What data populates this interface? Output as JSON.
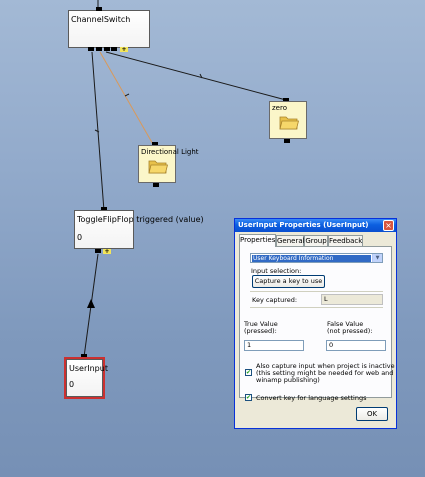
{
  "canvas": {
    "background_color": "#8fa8cb",
    "wire_color": "#1a1a1a",
    "highlight_wire_color": "#d9995a"
  },
  "nodes": {
    "channel_switch": {
      "title": "ChannelSwitch"
    },
    "zero": {
      "title": "zero"
    },
    "directional_light": {
      "title": "Directional Light"
    },
    "toggle_flipflop": {
      "title": "ToggleFlipFlop triggered (value)",
      "value": "0"
    },
    "user_input": {
      "title": "UserInput",
      "value": "0"
    },
    "plus_glyph": "+"
  },
  "dialog": {
    "title": "UserInput Properties (UserInput)",
    "close_glyph": "×",
    "tabs": [
      {
        "label": "Properties",
        "active": true
      },
      {
        "label": "General",
        "active": false
      },
      {
        "label": "Group",
        "active": false
      },
      {
        "label": "Feedback",
        "active": false
      }
    ],
    "source_select": {
      "value": "User Keyboard Information",
      "arrow": "▼"
    },
    "input_selection_label": "Input selection:",
    "capture_button": "Capture a key to use",
    "key_captured_label": "Key captured:",
    "key_captured_value": "L",
    "true_value_label_line1": "True Value",
    "true_value_label_line2": "(pressed):",
    "true_value": "1",
    "false_value_label_line1": "False Value",
    "false_value_label_line2": "(not pressed):",
    "false_value": "0",
    "capture_inactive": {
      "checked": true,
      "line1": "Also capture input when project is inactive",
      "line2": "(this setting might be needed for web and",
      "line3": "winamp publishing)"
    },
    "convert_key": {
      "checked": true,
      "label": "Convert key for language settings"
    },
    "check_glyph": "✔",
    "ok_button": "OK"
  }
}
